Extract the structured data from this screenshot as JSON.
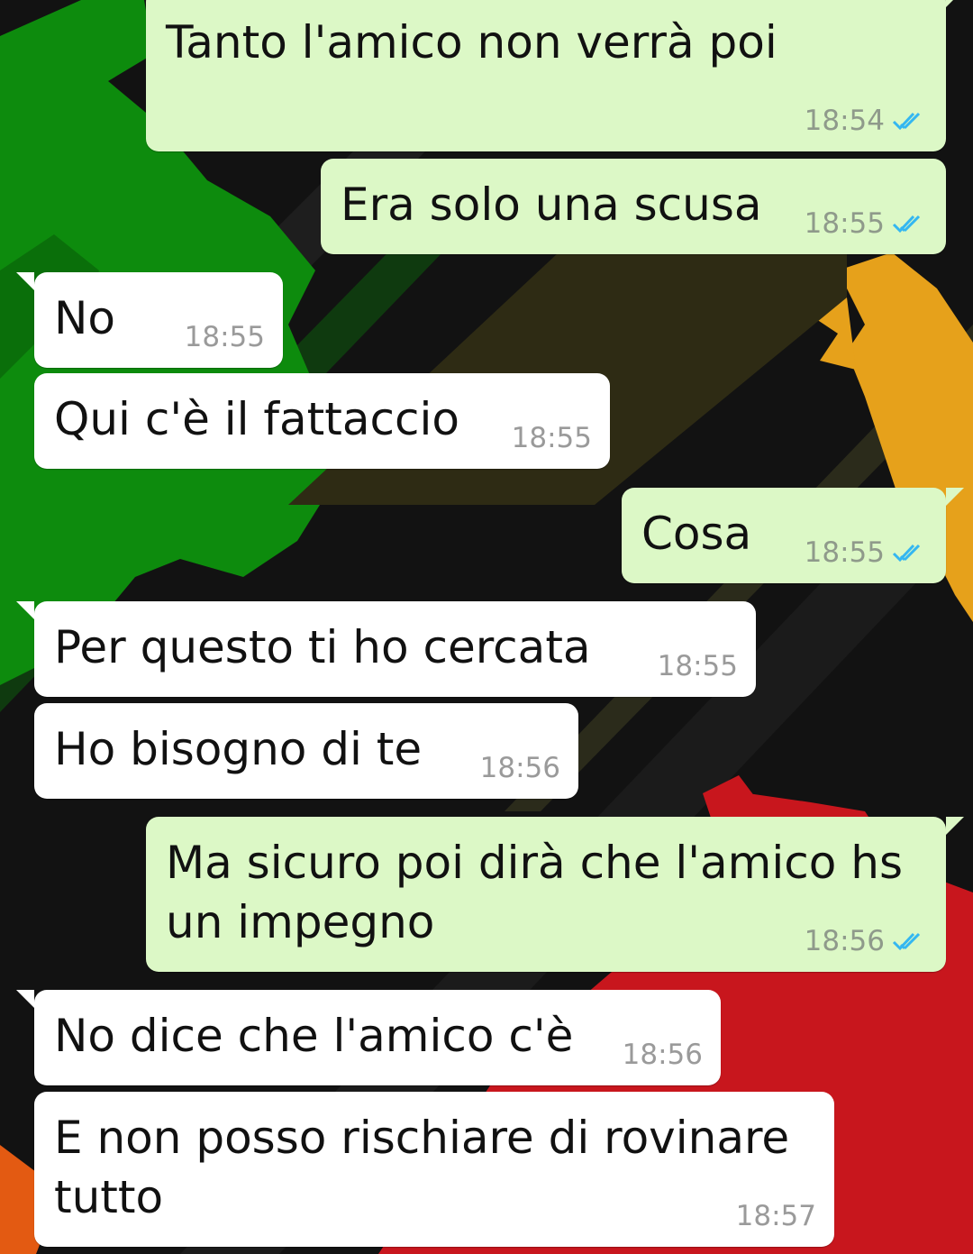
{
  "colors": {
    "outgoing_bubble": "#dcf8c6",
    "incoming_bubble": "#ffffff",
    "read_tick": "#34b7f1",
    "timestamp": "#8f9a8b",
    "wallpaper_bg": "#121212"
  },
  "icons": {
    "read_receipt": "double-check-icon"
  },
  "messages": [
    {
      "direction": "outgoing",
      "text": "Tanto l'amico non verrà poi",
      "time": "18:54",
      "status": "read"
    },
    {
      "direction": "outgoing",
      "text": "Era solo una scusa",
      "time": "18:55",
      "status": "read"
    },
    {
      "direction": "incoming",
      "text": "No",
      "time": "18:55"
    },
    {
      "direction": "incoming",
      "text": "Qui c'è il fattaccio",
      "time": "18:55"
    },
    {
      "direction": "outgoing",
      "text": "Cosa",
      "time": "18:55",
      "status": "read"
    },
    {
      "direction": "incoming",
      "text": "Per questo ti ho cercata",
      "time": "18:55"
    },
    {
      "direction": "incoming",
      "text": "Ho bisogno di te",
      "time": "18:56"
    },
    {
      "direction": "outgoing",
      "text": "Ma sicuro poi dirà che l'amico hs\nun impegno",
      "time": "18:56",
      "status": "read"
    },
    {
      "direction": "incoming",
      "text": "No dice che l'amico c'è",
      "time": "18:56"
    },
    {
      "direction": "incoming",
      "text": "E non posso rischiare di rovinare\ntutto",
      "time": "18:57"
    }
  ]
}
